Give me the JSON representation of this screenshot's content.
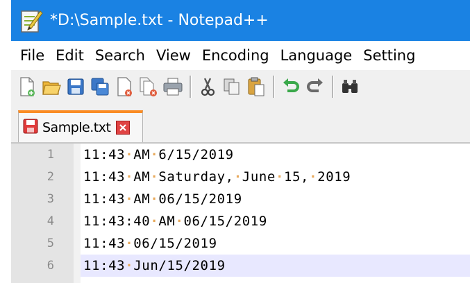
{
  "window": {
    "title": "*D:\\Sample.txt - Notepad++",
    "app_icon": "notepadpp-icon"
  },
  "menu": [
    "File",
    "Edit",
    "Search",
    "View",
    "Encoding",
    "Language",
    "Setting"
  ],
  "toolbar": {
    "icons": [
      "new-file-icon",
      "open-file-icon",
      "save-icon",
      "save-all-icon",
      "close-icon",
      "close-all-icon",
      "print-icon",
      "cut-icon",
      "copy-icon",
      "paste-icon",
      "undo-icon",
      "redo-icon",
      "find-icon"
    ]
  },
  "tab": {
    "label": "Sample.txt",
    "status": "unsaved"
  },
  "editor": {
    "lines": [
      {
        "num": "1",
        "text": "11:43 AM 6/15/2019"
      },
      {
        "num": "2",
        "text": "11:43 AM Saturday, June 15, 2019"
      },
      {
        "num": "3",
        "text": "11:43 AM 06/15/2019"
      },
      {
        "num": "4",
        "text": "11:43:40 AM 06/15/2019"
      },
      {
        "num": "5",
        "text": "11:43 06/15/2019"
      },
      {
        "num": "6",
        "text": "11:43 Jun/15/2019"
      }
    ],
    "current_line": 6,
    "whitespace_marker_color": "#e8a95b",
    "current_line_color": "#e8e8ff"
  },
  "colors": {
    "titlebar": "#1a82e3",
    "tab_accent": "#fa8c24"
  }
}
